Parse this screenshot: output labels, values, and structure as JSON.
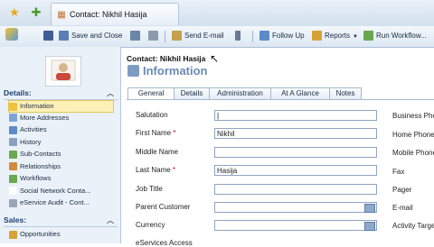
{
  "titlebar": {
    "title": "Contact: Nikhil Hasija"
  },
  "toolbar": {
    "save_close": "Save and Close",
    "send_email": "Send E-mail",
    "follow_up": "Follow Up",
    "reports": "Reports",
    "run_workflow": "Run Workflow..."
  },
  "nav": {
    "details_header": "Details:",
    "details_items": [
      "Information",
      "More Addresses",
      "Activities",
      "History",
      "Sub-Contacts",
      "Relationships",
      "Workflows",
      "Social Network Conta...",
      "eService Audit - Cont..."
    ],
    "sales_header": "Sales:",
    "sales_items": [
      "Opportunities"
    ]
  },
  "header": {
    "contact": "Contact: Nikhil Hasija",
    "section": "Information"
  },
  "tabs": [
    "General",
    "Details",
    "Administration",
    "At A Glance",
    "Notes"
  ],
  "form": {
    "fields": [
      {
        "label": "Salutation",
        "value": "",
        "required": false
      },
      {
        "label": "First Name",
        "value": "Nikhil",
        "required": true
      },
      {
        "label": "Middle Name",
        "value": "",
        "required": false
      },
      {
        "label": "Last Name",
        "value": "Hasija",
        "required": true
      },
      {
        "label": "Job Title",
        "value": "",
        "required": false
      },
      {
        "label": "Parent Customer",
        "value": "",
        "required": false
      },
      {
        "label": "Currency",
        "value": "",
        "required": false
      },
      {
        "label": "eServices Access",
        "value": "",
        "required": false
      }
    ],
    "right_labels": [
      "Business Phone",
      "Home Phone",
      "Mobile Phone",
      "Fax",
      "Pager",
      "E-mail",
      "Activity Target"
    ]
  }
}
